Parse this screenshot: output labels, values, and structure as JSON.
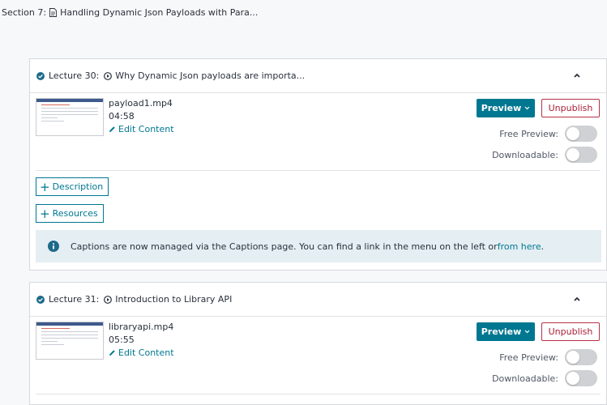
{
  "section": {
    "label": "Section 7:",
    "title": "Handling Dynamic Json Payloads with Para..."
  },
  "lectures": [
    {
      "label": "Lecture 30:",
      "title": "Why Dynamic Json payloads are importa...",
      "file_name": "payload1.mp4",
      "duration": "04:58",
      "edit_label": "Edit Content",
      "preview_label": "Preview",
      "unpublish_label": "Unpublish",
      "free_preview_label": "Free Preview:",
      "free_preview_on": false,
      "downloadable_label": "Downloadable:",
      "downloadable_on": false,
      "description_label": "Description",
      "resources_label": "Resources",
      "info": {
        "text_before": "Captions are now managed via the Captions page. You can find a link in the menu on the left or ",
        "link": "from here",
        "text_after": "."
      }
    },
    {
      "label": "Lecture 31:",
      "title": "Introduction to Library API",
      "file_name": "libraryapi.mp4",
      "duration": "05:55",
      "edit_label": "Edit Content",
      "preview_label": "Preview",
      "unpublish_label": "Unpublish",
      "free_preview_label": "Free Preview:",
      "free_preview_on": false,
      "downloadable_label": "Downloadable:",
      "downloadable_on": false
    }
  ],
  "colors": {
    "accent": "#007791",
    "danger": "#a81e33",
    "success": "#1e6a8a",
    "info_bg": "#e5eff3",
    "toggle_off": "#cfd1d4"
  },
  "icons": {
    "section": "document-icon",
    "lecture_status": "check-circle-icon",
    "lecture_type": "play-circle-icon",
    "collapse": "chevron-up-icon",
    "edit": "pencil-icon",
    "info": "info-circle-icon"
  }
}
